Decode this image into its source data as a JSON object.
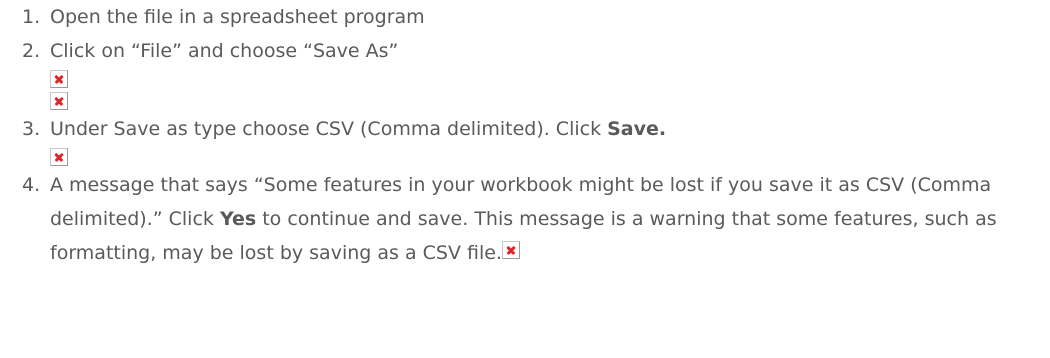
{
  "steps": [
    {
      "number": "1.",
      "text": "Open the file in a spreadsheet program"
    },
    {
      "number": "2.",
      "text": "Click on “File” and choose “Save As”"
    },
    {
      "number": "3.",
      "text_before": "Under Save as type choose CSV (Comma delimited). Click ",
      "bold": "Save."
    },
    {
      "number": "4.",
      "text_before": "A message that says “Some features in your workbook might be lost if you save it as CSV (Comma delimited).” Click ",
      "bold": "Yes",
      "text_after": " to continue and save. This message is a warning that some features, such as formatting, may be lost by saving as a CSV file."
    }
  ],
  "broken_image_icon": "broken-image-icon",
  "colors": {
    "text": "#5a5a5a",
    "broken_image_x": "#e0242b"
  }
}
